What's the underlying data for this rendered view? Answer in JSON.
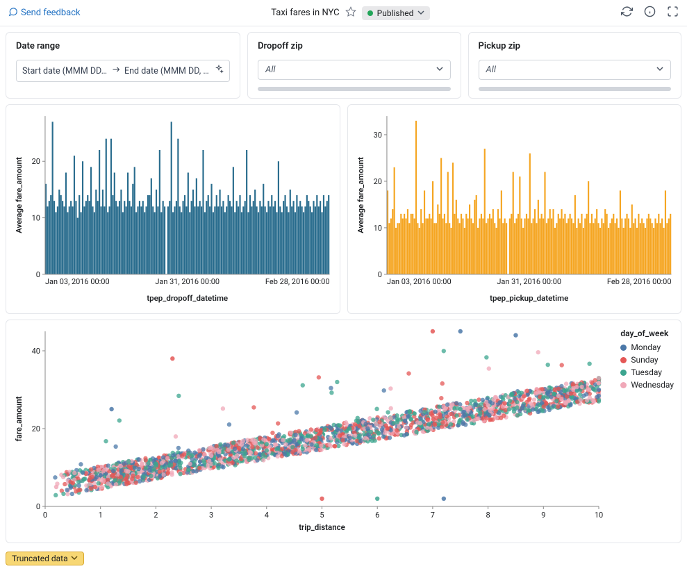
{
  "header": {
    "feedback": "Send feedback",
    "title": "Taxi fares in NYC",
    "status": "Published"
  },
  "filters": {
    "date_range": {
      "label": "Date range",
      "start_placeholder": "Start date (MMM DD,…",
      "end_placeholder": "End date (MMM DD, …"
    },
    "dropoff_zip": {
      "label": "Dropoff zip",
      "value": "All"
    },
    "pickup_zip": {
      "label": "Pickup zip",
      "value": "All"
    }
  },
  "truncated_label": "Truncated data",
  "legend_title": "day_of_week",
  "legend": [
    {
      "name": "Monday",
      "color": "#4b78a8"
    },
    {
      "name": "Sunday",
      "color": "#e45756"
    },
    {
      "name": "Tuesday",
      "color": "#3ca58f"
    },
    {
      "name": "Wednesday",
      "color": "#f0a8b8"
    }
  ],
  "chart_data": [
    {
      "type": "bar",
      "title": "",
      "xlabel": "tpep_dropoff_datetime",
      "ylabel": "Average fare_amount",
      "color": "#2a6d8e",
      "x_tick_labels": [
        "Jan 03, 2016 00:00",
        "Jan 31, 2016 00:00",
        "Feb 28, 2016 00:00"
      ],
      "y_ticks": [
        0,
        10,
        20
      ],
      "ylim": [
        0,
        28
      ],
      "values": [
        16,
        12,
        13,
        14,
        27,
        13,
        11,
        12,
        15,
        14,
        13,
        12,
        18,
        11,
        12,
        13,
        12,
        21,
        13,
        10,
        14,
        11,
        20,
        12,
        13,
        14,
        13,
        19,
        12,
        11,
        15,
        13,
        22,
        12,
        15,
        12,
        24,
        11,
        12,
        24,
        14,
        18,
        13,
        12,
        13,
        15,
        11,
        13,
        12,
        18,
        13,
        12,
        16,
        19,
        11,
        12,
        13,
        12,
        13,
        11,
        12,
        14,
        14,
        17,
        12,
        11,
        15,
        12,
        22,
        11,
        13,
        12,
        0,
        12,
        13,
        27,
        11,
        12,
        13,
        24,
        12,
        11,
        13,
        14,
        12,
        18,
        11,
        13,
        15,
        12,
        17,
        12,
        13,
        12,
        22,
        11,
        13,
        14,
        12,
        16,
        11,
        12,
        14,
        12,
        15,
        12,
        13,
        11,
        12,
        14,
        13,
        12,
        19,
        11,
        13,
        12,
        14,
        11,
        12,
        13,
        22,
        11,
        14,
        12,
        13,
        15,
        12,
        11,
        13,
        12,
        16,
        12,
        11,
        13,
        12,
        14,
        12,
        13,
        11,
        20,
        12,
        11,
        13,
        14,
        12,
        11,
        15,
        12,
        13,
        11,
        14,
        12,
        13,
        12,
        11,
        12,
        14,
        13,
        12,
        11,
        13,
        12,
        14,
        12,
        13,
        11,
        14,
        12,
        13,
        14
      ]
    },
    {
      "type": "bar",
      "title": "",
      "xlabel": "tpep_pickup_datetime",
      "ylabel": "Average fare_amount",
      "color": "#f5a623",
      "x_tick_labels": [
        "Jan 03, 2016 00:00",
        "Jan 31, 2016 00:00",
        "Feb 28, 2016 00:00"
      ],
      "y_ticks": [
        0,
        10,
        20,
        30
      ],
      "ylim": [
        0,
        34
      ],
      "values": [
        18,
        11,
        12,
        14,
        23,
        10,
        11,
        11,
        13,
        12,
        13,
        12,
        14,
        11,
        13,
        13,
        12,
        33,
        11,
        10,
        14,
        11,
        18,
        12,
        12,
        13,
        12,
        20,
        11,
        11,
        15,
        13,
        25,
        12,
        13,
        11,
        22,
        11,
        10,
        24,
        13,
        16,
        12,
        11,
        13,
        12,
        10,
        13,
        12,
        15,
        12,
        11,
        16,
        17,
        10,
        12,
        13,
        12,
        27,
        11,
        12,
        13,
        12,
        14,
        11,
        10,
        14,
        12,
        18,
        11,
        12,
        11,
        0,
        12,
        13,
        22,
        11,
        12,
        13,
        21,
        12,
        10,
        12,
        13,
        12,
        26,
        11,
        12,
        14,
        11,
        16,
        12,
        13,
        12,
        22,
        11,
        12,
        14,
        12,
        14,
        10,
        11,
        13,
        12,
        14,
        12,
        13,
        11,
        12,
        13,
        12,
        11,
        17,
        10,
        12,
        11,
        13,
        10,
        12,
        13,
        20,
        11,
        13,
        11,
        12,
        14,
        11,
        10,
        12,
        11,
        14,
        13,
        10,
        11,
        12,
        13,
        11,
        12,
        10,
        18,
        12,
        10,
        12,
        13,
        12,
        10,
        15,
        11,
        12,
        10,
        13,
        11,
        12,
        11,
        10,
        12,
        13,
        12,
        11,
        10,
        12,
        11,
        13,
        11,
        12,
        10,
        18,
        11,
        12,
        13
      ]
    },
    {
      "type": "scatter",
      "xlabel": "trip_distance",
      "ylabel": "fare_amount",
      "xlim": [
        0,
        10
      ],
      "ylim": [
        0,
        45
      ],
      "x_ticks": [
        0,
        1,
        2,
        3,
        4,
        5,
        6,
        7,
        8,
        9,
        10
      ],
      "y_ticks": [
        0,
        20,
        40
      ],
      "series": [
        {
          "name": "Monday",
          "color": "#4b78a8"
        },
        {
          "name": "Sunday",
          "color": "#e45756"
        },
        {
          "name": "Tuesday",
          "color": "#3ca58f"
        },
        {
          "name": "Wednesday",
          "color": "#f0a8b8"
        }
      ],
      "note": "Dense linear cloud rising from ~(0,5) to ~(10,30); occasional outliers near y=40-45 and a few near y=2 at x 5-8.",
      "sample_points": [
        {
          "x": 0.2,
          "y": 5,
          "c": "#f0a8b8"
        },
        {
          "x": 0.5,
          "y": 6,
          "c": "#e45756"
        },
        {
          "x": 0.7,
          "y": 7,
          "c": "#3ca58f"
        },
        {
          "x": 1.0,
          "y": 8,
          "c": "#4b78a8"
        },
        {
          "x": 1.2,
          "y": 25,
          "c": "#4b78a8"
        },
        {
          "x": 1.5,
          "y": 9,
          "c": "#f0a8b8"
        },
        {
          "x": 2.0,
          "y": 11,
          "c": "#3ca58f"
        },
        {
          "x": 2.3,
          "y": 38,
          "c": "#e45756"
        },
        {
          "x": 3.0,
          "y": 13,
          "c": "#f0a8b8"
        },
        {
          "x": 3.5,
          "y": 15,
          "c": "#e45756"
        },
        {
          "x": 4.0,
          "y": 16,
          "c": "#3ca58f"
        },
        {
          "x": 4.5,
          "y": 17,
          "c": "#4b78a8"
        },
        {
          "x": 5.0,
          "y": 2,
          "c": "#e45756"
        },
        {
          "x": 5.5,
          "y": 20,
          "c": "#3ca58f"
        },
        {
          "x": 6.0,
          "y": 2,
          "c": "#3ca58f"
        },
        {
          "x": 6.5,
          "y": 22,
          "c": "#4b78a8"
        },
        {
          "x": 7.0,
          "y": 45,
          "c": "#e45756"
        },
        {
          "x": 7.2,
          "y": 2,
          "c": "#4b78a8"
        },
        {
          "x": 7.5,
          "y": 25,
          "c": "#3ca58f"
        },
        {
          "x": 7.5,
          "y": 45,
          "c": "#4b78a8"
        },
        {
          "x": 8.0,
          "y": 26,
          "c": "#f0a8b8"
        },
        {
          "x": 8.5,
          "y": 44,
          "c": "#4b78a8"
        },
        {
          "x": 9.0,
          "y": 28,
          "c": "#3ca58f"
        },
        {
          "x": 9.5,
          "y": 29,
          "c": "#e45756"
        },
        {
          "x": 10.0,
          "y": 30,
          "c": "#4b78a8"
        }
      ]
    }
  ]
}
